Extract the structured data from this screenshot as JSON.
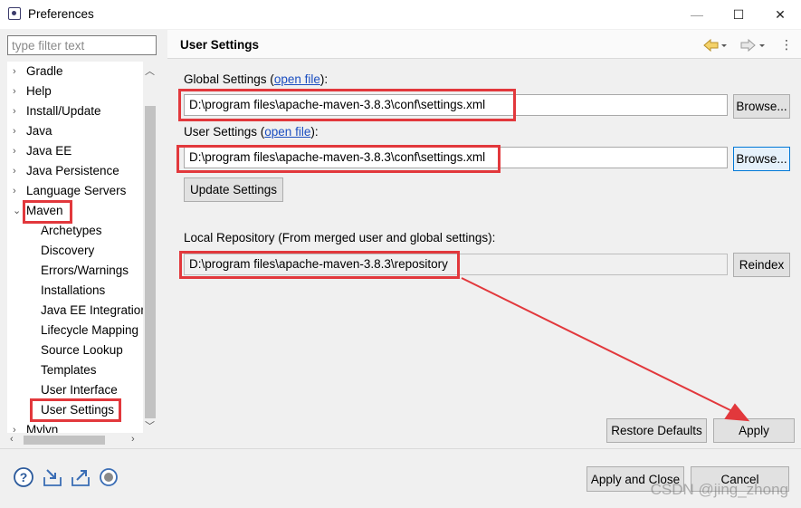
{
  "window": {
    "title": "Preferences",
    "minimize_glyph": "—",
    "maximize_glyph": "☐",
    "close_glyph": "✕"
  },
  "filter": {
    "placeholder": "type filter text"
  },
  "tree": {
    "items": [
      {
        "label": "Gradle",
        "expander": "›"
      },
      {
        "label": "Help",
        "expander": "›"
      },
      {
        "label": "Install/Update",
        "expander": "›"
      },
      {
        "label": "Java",
        "expander": "›"
      },
      {
        "label": "Java EE",
        "expander": "›"
      },
      {
        "label": "Java Persistence",
        "expander": "›"
      },
      {
        "label": "Language Servers",
        "expander": "›"
      },
      {
        "label": "Maven",
        "expander": "⌄"
      },
      {
        "label": "Archetypes"
      },
      {
        "label": "Discovery"
      },
      {
        "label": "Errors/Warnings"
      },
      {
        "label": "Installations"
      },
      {
        "label": "Java EE Integration"
      },
      {
        "label": "Lifecycle Mapping"
      },
      {
        "label": "Source Lookup"
      },
      {
        "label": "Templates"
      },
      {
        "label": "User Interface"
      },
      {
        "label": "User Settings"
      },
      {
        "label": "Mylyn",
        "expander": "›"
      }
    ]
  },
  "page": {
    "title": "User Settings",
    "global_label": "Global Settings (",
    "global_link": "open file",
    "label_close": "):",
    "global_path": "D:\\program files\\apache-maven-3.8.3\\conf\\settings.xml",
    "user_label": "User Settings (",
    "user_link": "open file",
    "user_path": "D:\\program files\\apache-maven-3.8.3\\conf\\settings.xml",
    "browse_label": "Browse...",
    "update_label": "Update Settings",
    "local_repo_label": "Local Repository (From merged user and global settings):",
    "local_repo_path": "D:\\program files\\apache-maven-3.8.3\\repository",
    "reindex_label": "Reindex",
    "restore_label": "Restore Defaults",
    "apply_label": "Apply"
  },
  "footer": {
    "apply_close_label": "Apply and Close",
    "cancel_label": "Cancel"
  },
  "watermark": "CSDN @jing_zhong",
  "colors": {
    "highlight": "#e2383c",
    "link": "#1b4ec0"
  }
}
